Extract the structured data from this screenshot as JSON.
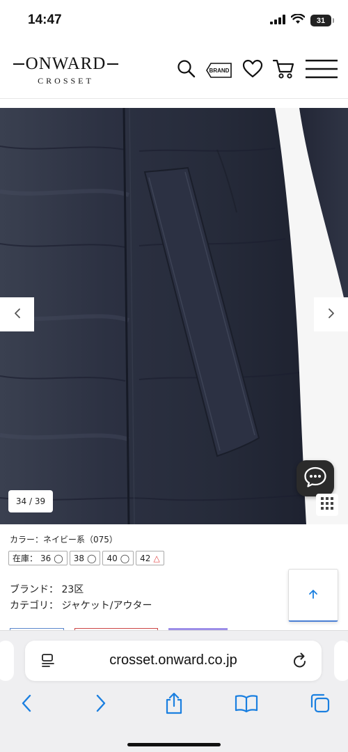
{
  "status_bar": {
    "time": "14:47",
    "battery": "31",
    "icons": [
      "signal-icon",
      "wifi-icon",
      "battery-icon"
    ]
  },
  "header": {
    "logo_main": "ONWARD",
    "logo_sub": "CROSSET",
    "brand_label": "BRAND",
    "icons": [
      "search-icon",
      "brand-tag-icon",
      "heart-icon",
      "cart-icon",
      "menu-icon"
    ]
  },
  "gallery": {
    "counter": "34 / 39",
    "prev_icon": "chevron-left-icon",
    "next_icon": "chevron-right-icon"
  },
  "product": {
    "color_line": "カラー：ネイビー系（075）",
    "stock_label": "在庫：",
    "sizes": [
      {
        "size": "36",
        "mark": "◯"
      },
      {
        "size": "38",
        "mark": "◯"
      },
      {
        "size": "40",
        "mark": "◯"
      },
      {
        "size": "42",
        "mark": "△"
      }
    ],
    "brand_line": "ブランド： 23区",
    "category_line": "カテゴリ： ジャケット/アウター"
  },
  "browser": {
    "url": "crosset.onward.co.jp",
    "toolbar_icons": [
      "back-icon",
      "forward-icon",
      "share-icon",
      "bookmarks-icon",
      "tabs-icon"
    ]
  },
  "colors": {
    "accent_blue": "#1a7fe0",
    "warn_red": "#e04848",
    "coat_navy": "#2a2f40"
  }
}
